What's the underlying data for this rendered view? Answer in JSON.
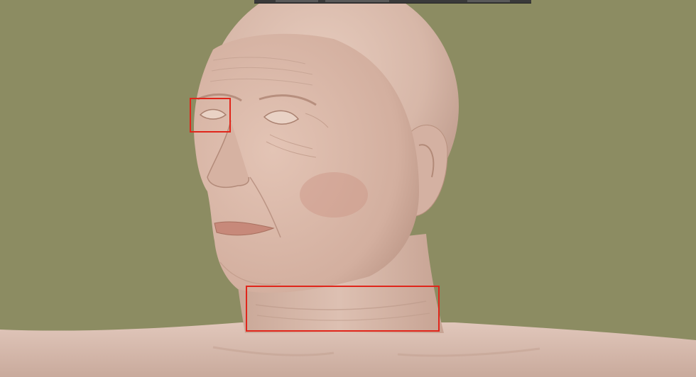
{
  "viewport": {
    "background_color": "#8c8c62",
    "subject": "3d-head-bust-render"
  },
  "colors": {
    "highlight": "#e0261b",
    "skin": "#dcbcad",
    "toolbar": "#3a3a3a"
  },
  "annotations": [
    {
      "name": "eye-region",
      "color": "#e0261b"
    },
    {
      "name": "neck-region",
      "color": "#e0261b"
    }
  ]
}
